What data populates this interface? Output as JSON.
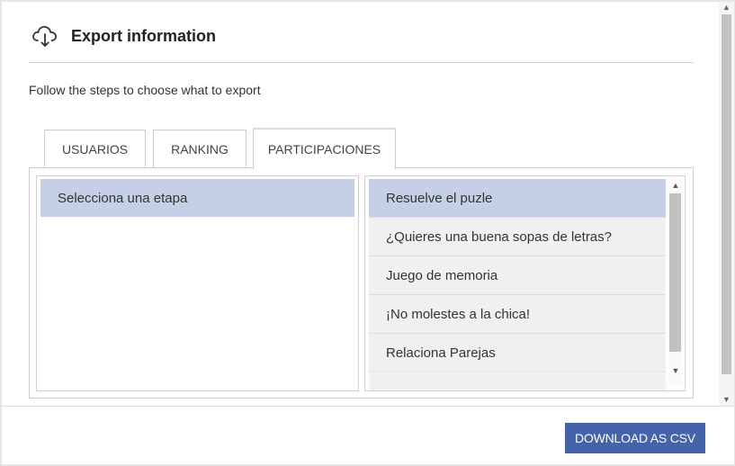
{
  "dialog": {
    "title": "Export information",
    "title_icon": "cloud-download-icon",
    "subtitle": "Follow the steps to choose what to export"
  },
  "tabs": [
    {
      "label": "USUARIOS",
      "active": false
    },
    {
      "label": "RANKING",
      "active": false
    },
    {
      "label": "PARTICIPACIONES",
      "active": true
    }
  ],
  "left_list": {
    "items": [
      {
        "label": "Selecciona una etapa",
        "selected": true
      }
    ]
  },
  "right_list": {
    "items": [
      {
        "label": "Resuelve el puzle",
        "selected": true
      },
      {
        "label": "¿Quieres una buena sopas de letras?",
        "selected": false
      },
      {
        "label": "Juego de memoria",
        "selected": false
      },
      {
        "label": "¡No molestes a la chica!",
        "selected": false
      },
      {
        "label": "Relaciona Parejas",
        "selected": false
      }
    ],
    "scroll_up_icon": "triangle-up-icon",
    "scroll_down_icon": "triangle-down-icon"
  },
  "footer": {
    "download_label": "DOWNLOAD AS CSV"
  },
  "colors": {
    "accent": "#4463ab",
    "selection": "#c5d0e6",
    "item_bg": "#f0f0f0"
  }
}
